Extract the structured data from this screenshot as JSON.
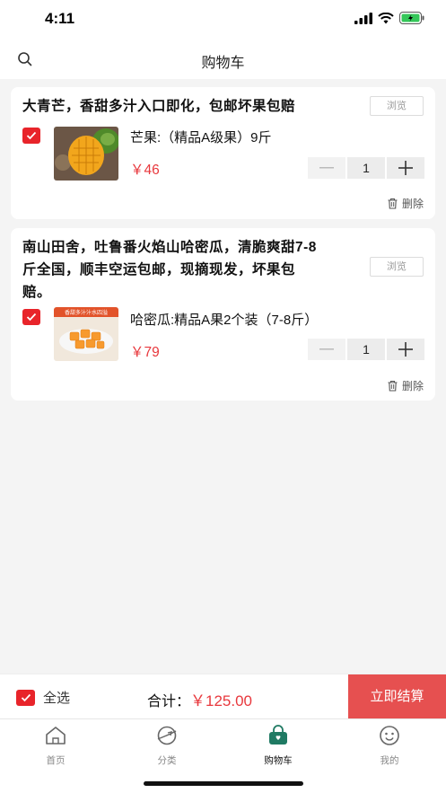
{
  "status_bar": {
    "time": "4:11"
  },
  "nav": {
    "title": "购物车"
  },
  "cart": {
    "items": [
      {
        "store_title": "大青芒，香甜多汁入口即化，包邮坏果包赔",
        "browse_label": "浏览",
        "product_name": "芒果:（精品A级果）9斤",
        "price": "￥46",
        "quantity": "1",
        "delete_label": "删除"
      },
      {
        "store_title_line1": "南山田舍，吐鲁番火焰山哈密瓜，清脆爽甜7-8",
        "store_title_line2": "斤全国，顺丰空运包邮，现摘现发，坏果包",
        "store_title_line3": "赔。",
        "browse_label": "浏览",
        "thumb_caption": "香甜多汁汁水四溢",
        "product_name": "哈密瓜:精品A果2个装（7-8斤）",
        "price": "￥79",
        "quantity": "1",
        "delete_label": "删除"
      }
    ]
  },
  "checkout": {
    "select_all_label": "全选",
    "total_label": "合计：",
    "total_value": "￥125.00",
    "button_label": "立即结算"
  },
  "tabs": [
    {
      "label": "首页",
      "icon": "home-icon"
    },
    {
      "label": "分类",
      "icon": "category-icon"
    },
    {
      "label": "购物车",
      "icon": "cart-icon"
    },
    {
      "label": "我的",
      "icon": "profile-icon"
    }
  ],
  "colors": {
    "accent_red": "#e8242a",
    "price_red": "#e8383d",
    "checkout_red": "#e65050",
    "tab_active_green": "#1f7a63"
  }
}
